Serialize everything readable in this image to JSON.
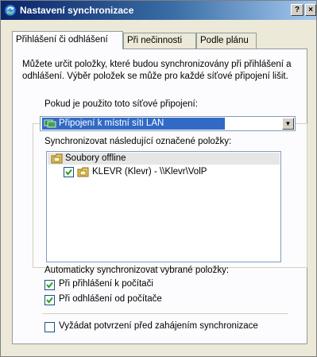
{
  "window": {
    "title": "Nastavení synchronizace",
    "help_btn": "?",
    "close_btn": "×"
  },
  "tabs": [
    {
      "label": "Přihlášení či odhlášení",
      "active": true
    },
    {
      "label": "Při nečinnosti",
      "active": false
    },
    {
      "label": "Podle plánu",
      "active": false
    }
  ],
  "description": "Můžete určit položky, které budou synchronizovány při přihlášení a odhlášení. Výběr položek se může pro každé síťové připojení lišit.",
  "connection": {
    "label": "Pokud je použito toto síťové připojení:",
    "selected": "Připojení k místní síti LAN"
  },
  "sync_items": {
    "label": "Synchronizovat následující označené položky:",
    "group": "Soubory offline",
    "items": [
      {
        "label": "KLEVR (Klevr) - \\\\Klevr\\VolP",
        "checked": true
      }
    ]
  },
  "auto_sync": {
    "label": "Automaticky synchronizovat vybrané položky:",
    "options": [
      {
        "label": "Při přihlášení k počítači",
        "checked": true
      },
      {
        "label": "Při odhlášení od počítače",
        "checked": true
      }
    ]
  },
  "confirm": {
    "label": "Vyžádat potvrzení před zahájením synchronizace",
    "checked": false
  },
  "colors": {
    "titlebar_start": "#0a246a",
    "titlebar_end": "#a6caf0",
    "selection": "#316ac5",
    "dialog_bg": "#ece9d8"
  }
}
